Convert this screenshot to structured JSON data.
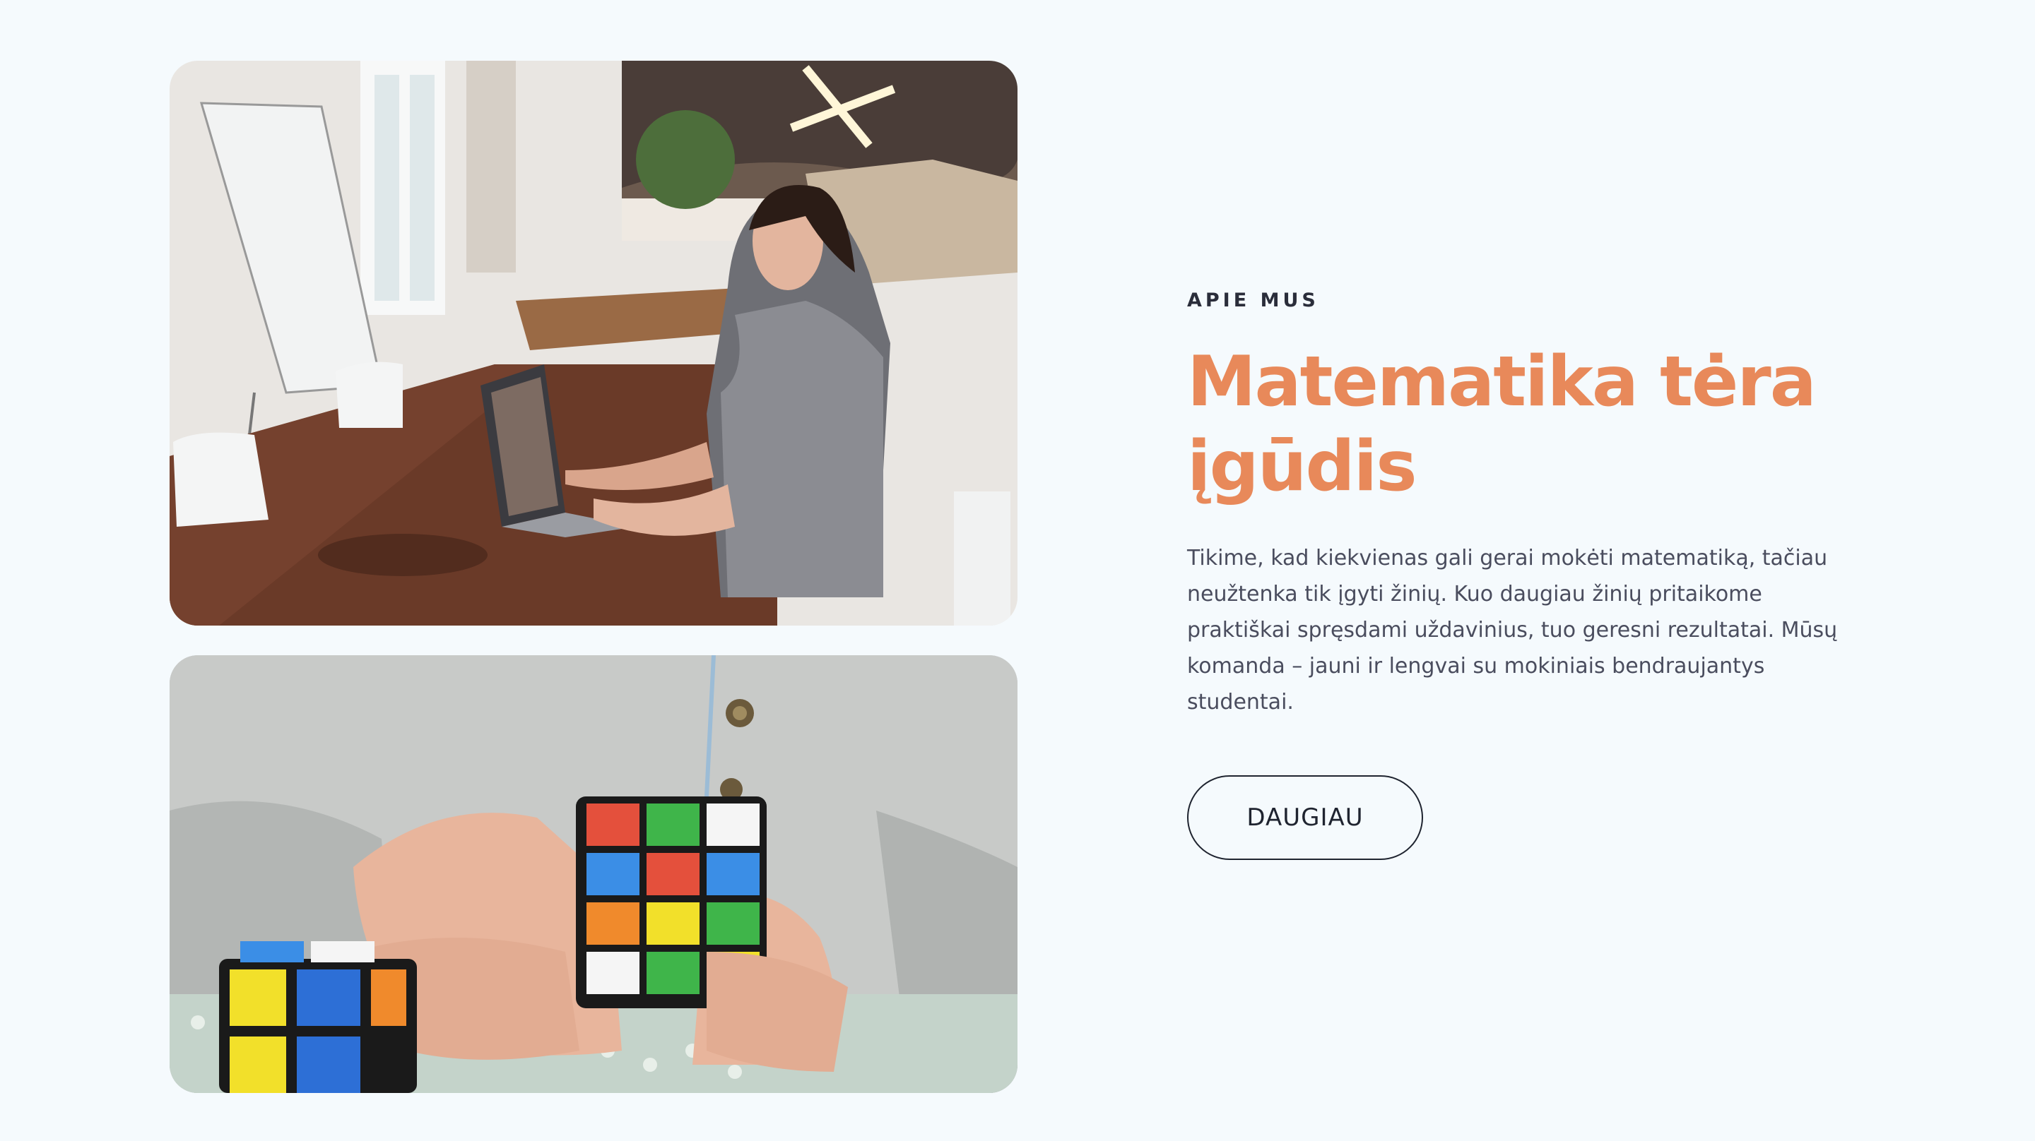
{
  "about": {
    "eyebrow": "APIE MUS",
    "title": "Matematika tėra įgūdis",
    "body": "Tikime, kad kiekvienas gali gerai mokėti matematiką, tačiau neužtenka tik įgyti žinių. Kuo daugiau žinių pritaikome praktiškai spręsdami uždavinius, tuo geresni rezultatai. Mūsų komanda – jauni ir lengvai su mokiniais bendraujantys studentai.",
    "button_label": "DAUGIAU"
  },
  "colors": {
    "background": "#f5fafd",
    "accent": "#e8895a",
    "text": "#4a4d5e",
    "heading": "#2a2d3a"
  }
}
